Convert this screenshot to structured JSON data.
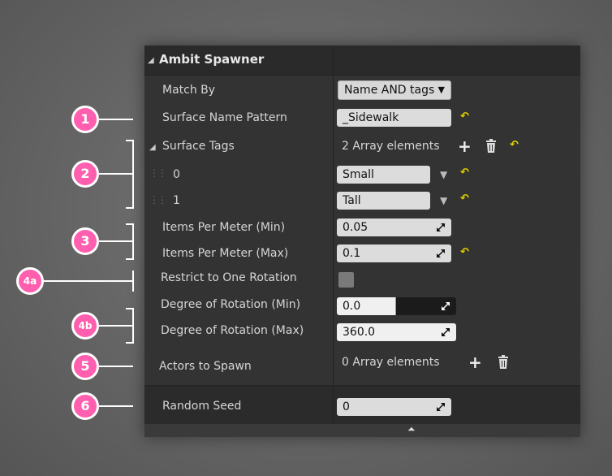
{
  "panel": {
    "title": "Ambit Spawner",
    "rows": {
      "match_by": {
        "label": "Match By",
        "value": "Name AND tags"
      },
      "surface_name_pattern": {
        "label": "Surface Name Pattern",
        "value": "_Sidewalk"
      },
      "surface_tags": {
        "label": "Surface Tags",
        "summary": "2 Array elements",
        "items": [
          {
            "index": "0",
            "value": "Small"
          },
          {
            "index": "1",
            "value": "Tall"
          }
        ]
      },
      "items_per_meter_min": {
        "label": "Items Per Meter (Min)",
        "value": "0.05"
      },
      "items_per_meter_max": {
        "label": "Items Per Meter (Max)",
        "value": "0.1"
      },
      "restrict_rotation": {
        "label": "Restrict to One Rotation",
        "checked": false
      },
      "rotation_min": {
        "label": "Degree of Rotation (Min)",
        "value": "0.0"
      },
      "rotation_max": {
        "label": "Degree of Rotation (Max)",
        "value": "360.0"
      },
      "actors_to_spawn": {
        "label": "Actors to Spawn",
        "summary": "0 Array elements"
      },
      "random_seed": {
        "label": "Random Seed",
        "value": "0"
      }
    }
  },
  "callouts": [
    "1",
    "2",
    "3",
    "4a",
    "4b",
    "5",
    "6"
  ],
  "colors": {
    "callout": "#ff5fae",
    "reset": "#e0d000",
    "panel": "#333333"
  }
}
